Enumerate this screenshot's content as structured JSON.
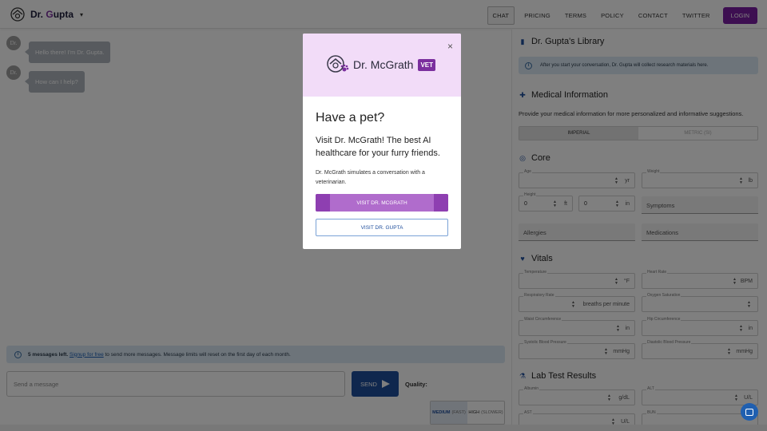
{
  "header": {
    "brand": {
      "part1": "Dr. ",
      "part2": "G",
      "part3": "upta",
      "caret": "▾"
    },
    "nav": [
      "CHAT",
      "PRICING",
      "TERMS",
      "POLICY",
      "CONTACT",
      "TWITTER"
    ],
    "login": "LOGIN"
  },
  "chat": {
    "avatar_label": "Dr.",
    "messages": [
      "Hello there! I'm Dr. Gupta.",
      "How can I help?"
    ],
    "limit": {
      "count": "5 messages left.",
      "link": "Signup for free",
      "rest": " to send more messages. Message limits will reset on the first day of each month."
    },
    "input_placeholder": "Send a message",
    "send_label": "SEND",
    "quality_label": "Quality:",
    "quality_options": [
      {
        "label": "MEDIUM",
        "sub": "(FAST)"
      },
      {
        "label": "HIGH",
        "sub": "(SLOWER)"
      }
    ]
  },
  "panel": {
    "library_title": "Dr. Gupta's Library",
    "library_note": "After you start your conversation, Dr. Gupta will collect research materials here.",
    "medical_title": "Medical Information",
    "medical_desc": "Provide your medical information for more personalized and informative suggestions.",
    "units": [
      "IMPERIAL",
      "METRIC (SI)"
    ],
    "core_title": "Core",
    "core": {
      "age": {
        "label": "Age",
        "unit": "yr"
      },
      "weight": {
        "label": "Weight",
        "unit": "lb"
      },
      "height": {
        "label": "Height",
        "ft_value": "0",
        "ft_unit": "ft",
        "in_value": "0",
        "in_unit": "in"
      },
      "symptoms": "Symptoms",
      "allergies": "Allergies",
      "medications": "Medications"
    },
    "vitals_title": "Vitals",
    "vitals": [
      {
        "label": "Temperature",
        "unit": "°F"
      },
      {
        "label": "Heart Rate",
        "unit": "BPM"
      },
      {
        "label": "Respiratory Rate",
        "unit": "breaths per minute"
      },
      {
        "label": "Oxygen Saturation",
        "unit": ""
      },
      {
        "label": "Waist Circumference",
        "unit": "in"
      },
      {
        "label": "Hip Circumference",
        "unit": "in"
      },
      {
        "label": "Systolic Blood Pressure",
        "unit": "mmHg"
      },
      {
        "label": "Diastolic Blood Pressure",
        "unit": "mmHg"
      }
    ],
    "lab_title": "Lab Test Results",
    "labs": [
      {
        "label": "Albumin",
        "unit": "g/dL"
      },
      {
        "label": "ALT",
        "unit": "U/L"
      },
      {
        "label": "AST",
        "unit": "U/L"
      },
      {
        "label": "BUN",
        "unit": ""
      }
    ]
  },
  "modal": {
    "brand": "Dr. McGrath",
    "badge": "VET",
    "title": "Have a pet?",
    "lead": "Visit Dr. McGrath! The best AI healthcare for your furry friends.",
    "desc": "Dr. McGrath simulates a conversation with a veterinarian.",
    "primary": "VISIT DR. MCGRATH",
    "secondary": "VISIT DR. GUPTA",
    "close": "×"
  },
  "colors": {
    "primary": "#1f4e9c",
    "purple": "#7b1fa2",
    "info_bg": "#dbe9f5",
    "modal_head": "#f2dcf8"
  }
}
